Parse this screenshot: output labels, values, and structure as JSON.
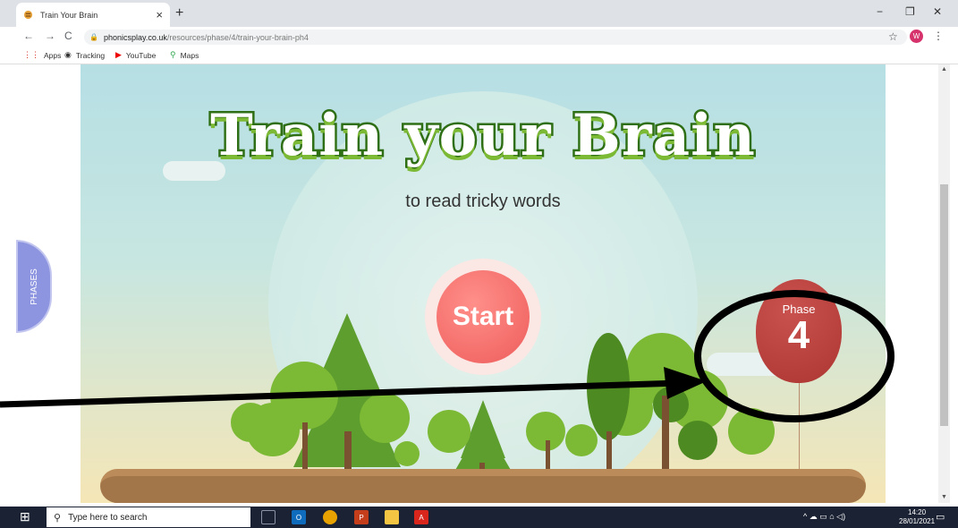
{
  "browser": {
    "tab_title": "Train Your Brain",
    "tab_close": "×",
    "new_tab": "+",
    "url_host": "phonicsplay.co.uk",
    "url_path": "/resources/phase/4/train-your-brain-ph4",
    "back": "←",
    "forward": "→",
    "reload": "C",
    "lock": "🔒",
    "star": "☆",
    "profile_initial": "W",
    "menu": "⋮",
    "minimize": "−",
    "restore": "❐",
    "close": "✕"
  },
  "bookmarks": [
    {
      "label": "Apps",
      "icon": "apps-grid-icon",
      "glyph": "⋮⋮"
    },
    {
      "label": "Tracking",
      "icon": "globe-icon",
      "glyph": "◉"
    },
    {
      "label": "YouTube",
      "icon": "youtube-icon",
      "glyph": "▶"
    },
    {
      "label": "Maps",
      "icon": "maps-pin-icon",
      "glyph": "⚲"
    }
  ],
  "game": {
    "title": "Train your Brain",
    "subtitle": "to read tricky words",
    "start_label": "Start",
    "phase_label": "Phase",
    "phase_number": "4",
    "phases_tab": "PHASES"
  },
  "taskbar": {
    "search_placeholder": "Type here to search",
    "time": "14:20",
    "date": "28/01/2021"
  },
  "colors": {
    "title_outline": "#2e6e14",
    "start_button": "#ee5d5b",
    "balloon": "#ad3633",
    "phases_tab": "#8e95e0"
  }
}
